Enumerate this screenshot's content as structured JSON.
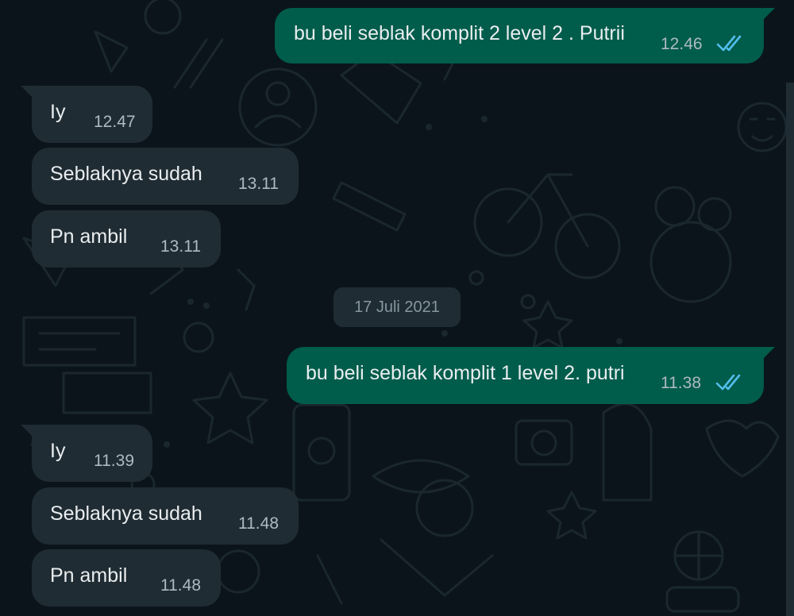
{
  "chat": {
    "date_separator": "17 Juli 2021",
    "messages": [
      {
        "direction": "outgoing",
        "text": "bu beli seblak komplit 2 level 2 . Putrii",
        "time": "12.46",
        "status": "read-ticks-icon"
      },
      {
        "direction": "incoming",
        "text": "Iy",
        "time": "12.47"
      },
      {
        "direction": "incoming",
        "text": "Seblaknya sudah",
        "time": "13.11"
      },
      {
        "direction": "incoming",
        "text": "Pn ambil",
        "time": "13.11"
      },
      {
        "direction": "outgoing",
        "text": "bu beli seblak komplit 1 level 2. putri",
        "time": "11.38",
        "status": "read-ticks-icon"
      },
      {
        "direction": "incoming",
        "text": "Iy",
        "time": "11.39"
      },
      {
        "direction": "incoming",
        "text": "Seblaknya sudah",
        "time": "11.48"
      },
      {
        "direction": "incoming",
        "text": "Pn ambil",
        "time": "11.48"
      }
    ]
  },
  "colors": {
    "background": "#0b141a",
    "incoming_bubble": "#202c33",
    "outgoing_bubble": "#005c4b",
    "read_ticks": "#53bdeb"
  }
}
